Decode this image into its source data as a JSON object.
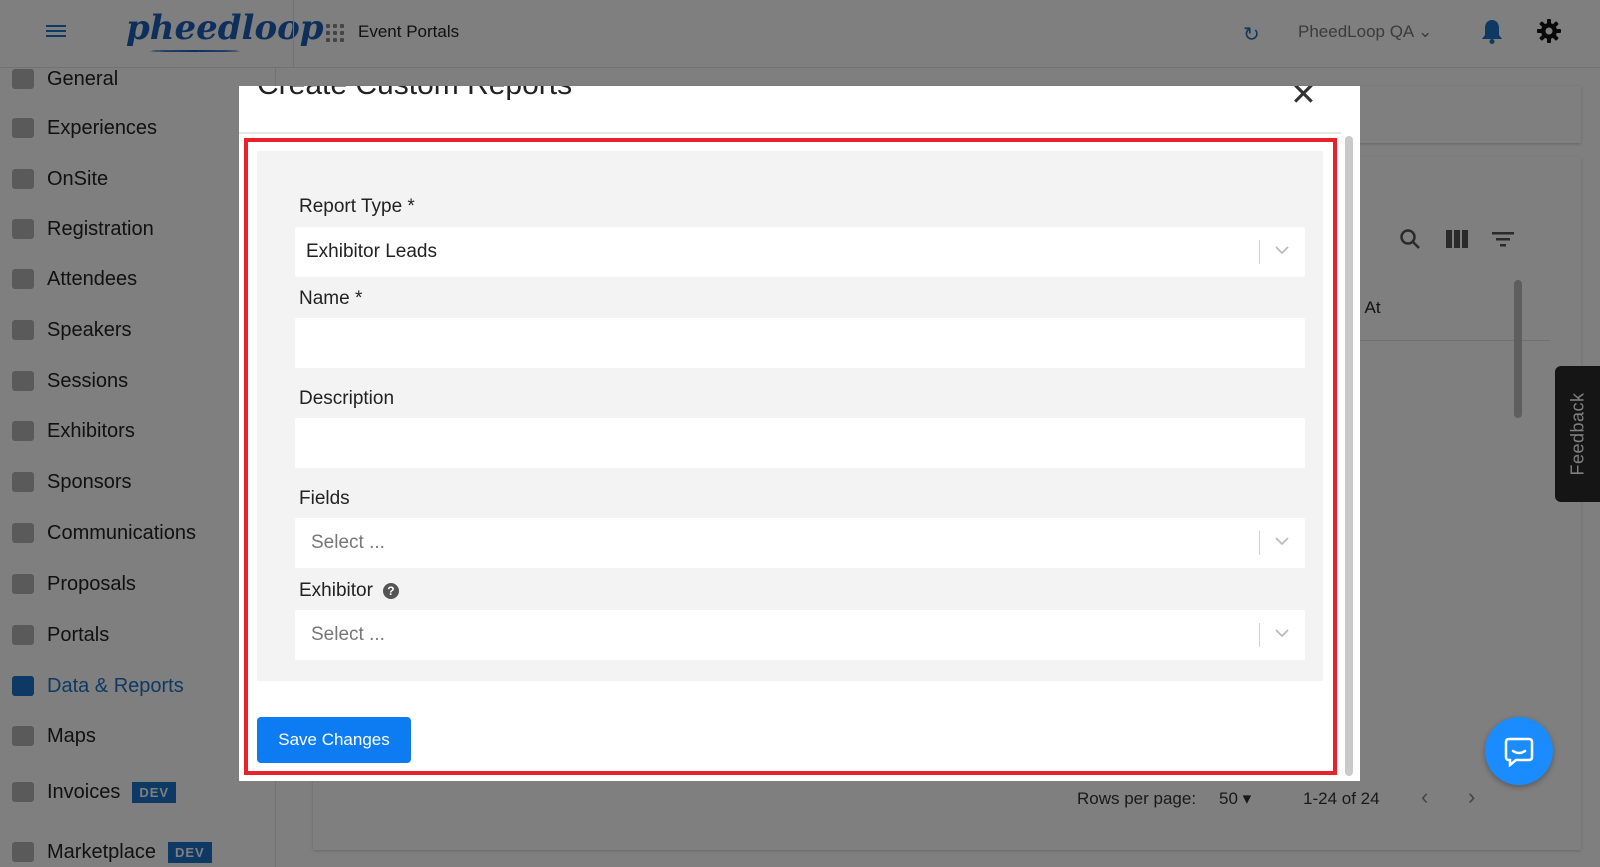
{
  "topbar": {
    "logo": "pheedloop",
    "portal_title": "Event Portals",
    "org_name": "PheedLoop QA"
  },
  "sidebar": {
    "items": [
      {
        "label": "General",
        "icon": "grid-icon"
      },
      {
        "label": "Experiences",
        "icon": "person-icon"
      },
      {
        "label": "OnSite",
        "icon": "printer-icon"
      },
      {
        "label": "Registration",
        "icon": "cart-icon"
      },
      {
        "label": "Attendees",
        "icon": "people-icon"
      },
      {
        "label": "Speakers",
        "icon": "presenter-icon"
      },
      {
        "label": "Sessions",
        "icon": "laptop-icon"
      },
      {
        "label": "Exhibitors",
        "icon": "store-icon"
      },
      {
        "label": "Sponsors",
        "icon": "badge-icon"
      },
      {
        "label": "Communications",
        "icon": "mail-icon"
      },
      {
        "label": "Proposals",
        "icon": "document-icon"
      },
      {
        "label": "Portals",
        "icon": "globe-icon"
      },
      {
        "label": "Data & Reports",
        "icon": "chart-icon",
        "active": true
      },
      {
        "label": "Maps",
        "icon": "map-icon"
      },
      {
        "label": "Invoices",
        "icon": "invoice-icon",
        "badge": "DEV"
      },
      {
        "label": "Marketplace",
        "icon": "cart-icon",
        "badge": "DEV"
      }
    ]
  },
  "table": {
    "column_partial": "l At",
    "rows_per_page_label": "Rows per page:",
    "rows_per_page_value": "50",
    "range": "1-24 of 24"
  },
  "feedback": {
    "label": "Feedback"
  },
  "modal": {
    "title": "Create Custom Reports",
    "fields": {
      "report_type": {
        "label": "Report Type *",
        "value": "Exhibitor Leads"
      },
      "name": {
        "label": "Name *",
        "value": ""
      },
      "description": {
        "label": "Description",
        "value": ""
      },
      "fields": {
        "label": "Fields",
        "placeholder": "Select ..."
      },
      "exhibitor": {
        "label": "Exhibitor",
        "placeholder": "Select ..."
      }
    },
    "save_label": "Save Changes"
  },
  "colors": {
    "accent": "#1a73c9",
    "primary_button": "#0d7cf2",
    "highlight_border": "#e8212a"
  }
}
